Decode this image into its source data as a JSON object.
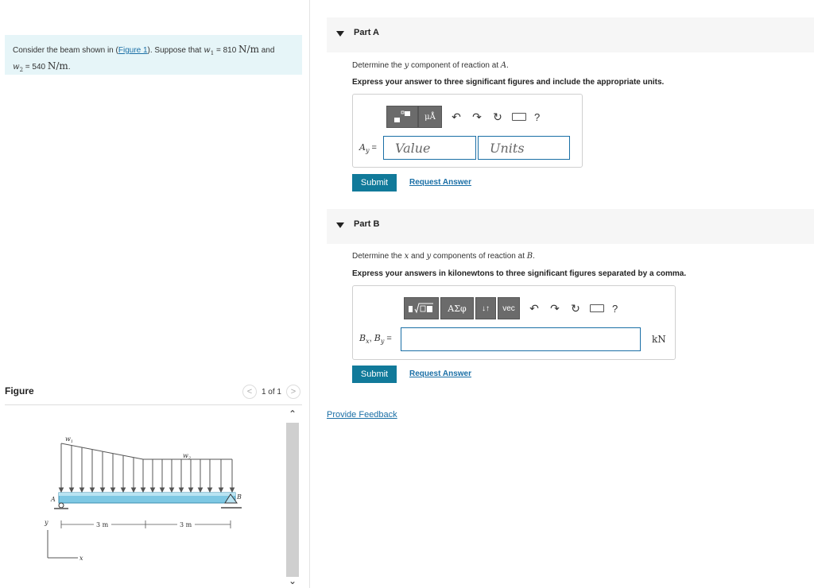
{
  "problem": {
    "text_prefix": "Consider the beam shown in (",
    "figure_link": "Figure 1",
    "text_mid": "). Suppose that ",
    "w1_sym": "w",
    "w1_sub": "1",
    "w1_val": " = 810 ",
    "w1_unit": "N/m",
    "and": " and",
    "w2_sym": "w",
    "w2_sub": "2",
    "w2_val": " = 540 ",
    "w2_unit": "N/m",
    "end": "."
  },
  "figure": {
    "title": "Figure",
    "pager": "1 of 1",
    "labels": {
      "w1": "w",
      "w1_sub": "1",
      "w2": "w",
      "w2_sub": "2",
      "A": "A",
      "B": "B",
      "dim1": "3 m",
      "dim2": "3 m",
      "y": "y",
      "x": "x"
    }
  },
  "partA": {
    "label": "Part A",
    "question_prefix": "Determine the ",
    "question_var": "y",
    "question_mid": " component of reaction at ",
    "question_pt": "A",
    "question_end": ".",
    "instruction": "Express your answer to three significant figures and include the appropriate units.",
    "var_label": "A",
    "var_sub": "y",
    "eq": " =",
    "value_placeholder": "Value",
    "units_placeholder": "Units",
    "toolbar_units": "μÅ",
    "submit": "Submit",
    "request": "Request Answer",
    "help": "?"
  },
  "partB": {
    "label": "Part B",
    "question_prefix": "Determine the ",
    "question_x": "x",
    "question_and": " and ",
    "question_y": "y",
    "question_mid": " components of reaction at ",
    "question_pt": "B",
    "question_end": ".",
    "instruction": "Express your answers in kilonewtons to three significant figures separated by a comma.",
    "var_label": "B",
    "var_sub1": "x",
    "comma": ", ",
    "var_label2": "B",
    "var_sub2": "y",
    "eq": " =",
    "unit": "kN",
    "greek": "ΑΣφ",
    "arrows": "↓↑",
    "vec": "vec",
    "submit": "Submit",
    "request": "Request Answer",
    "help": "?"
  },
  "feedback": "Provide Feedback",
  "colors": {
    "accent": "#117a9a",
    "link": "#1a6fa6",
    "problem_bg": "#e6f5f8",
    "beam": "#7ec8e3"
  }
}
